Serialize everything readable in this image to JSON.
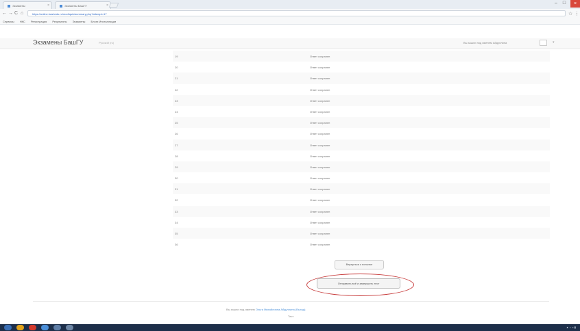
{
  "browser": {
    "tabs": [
      {
        "label": "Экзамены"
      },
      {
        "label": "Экзамены БашГУ"
      }
    ],
    "window_controls": [
      "–",
      "□",
      "×"
    ],
    "nav": [
      "←",
      "→",
      "C",
      "⌂"
    ],
    "url": "https://online.bashedu.ru/mod/quiz/summary.php?attempt=17",
    "bookmarks": [
      "Сервисы",
      "НКС",
      "Регистрация",
      "Результаты",
      "Экзамены",
      "Блоги Инсталляции"
    ]
  },
  "navbar": {
    "brand": "Экзамены БашГУ",
    "subtitle": "Русский (ru)",
    "right_text": "Вы зашли под именем Абдуллина",
    "user_glyph": "▾"
  },
  "questions": [
    {
      "num": "19",
      "status": "Ответ сохранен"
    },
    {
      "num": "20",
      "status": "Ответ сохранен"
    },
    {
      "num": "21",
      "status": "Ответ сохранен"
    },
    {
      "num": "22",
      "status": "Ответ сохранен"
    },
    {
      "num": "23",
      "status": "Ответ сохранен"
    },
    {
      "num": "24",
      "status": "Ответ сохранен"
    },
    {
      "num": "25",
      "status": "Ответ сохранен"
    },
    {
      "num": "26",
      "status": "Ответ сохранен"
    },
    {
      "num": "27",
      "status": "Ответ сохранен"
    },
    {
      "num": "28",
      "status": "Ответ сохранен"
    },
    {
      "num": "29",
      "status": "Ответ сохранен"
    },
    {
      "num": "30",
      "status": "Ответ сохранен"
    },
    {
      "num": "31",
      "status": "Ответ сохранен"
    },
    {
      "num": "32",
      "status": "Ответ сохранен"
    },
    {
      "num": "33",
      "status": "Ответ сохранен"
    },
    {
      "num": "34",
      "status": "Ответ сохранен"
    },
    {
      "num": "35",
      "status": "Ответ сохранен"
    },
    {
      "num": "36",
      "status": "Ответ сохранен"
    }
  ],
  "buttons": {
    "return_label": "Вернуться к попытке",
    "finish_label": "Отправить всё и завершить тест"
  },
  "footer": {
    "text": "Вы зашли под именем",
    "user_link": "Ольга Михайловна Абдуллина",
    "logout_link": "(Выход)",
    "home": "Тест"
  },
  "colors": {
    "highlight_ellipse": "#c73b3b",
    "link": "#4a8fd8",
    "taskbar": "#1d2f4a"
  }
}
